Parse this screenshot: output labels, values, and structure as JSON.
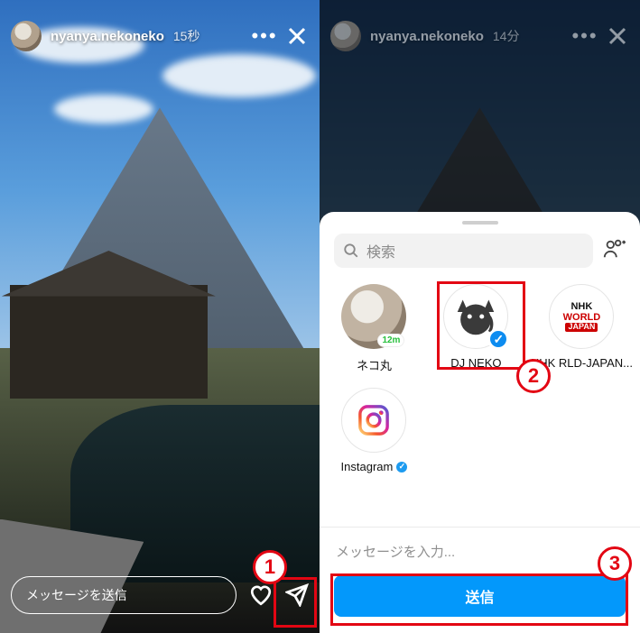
{
  "left": {
    "header": {
      "username": "nyanya.nekoneko",
      "timestamp": "15秒"
    },
    "footer": {
      "message_placeholder": "メッセージを送信"
    }
  },
  "right": {
    "header": {
      "username": "nyanya.nekoneko",
      "timestamp": "14分"
    },
    "sheet": {
      "search_placeholder": "検索",
      "contacts": [
        {
          "name": "ネコ丸",
          "active": "12m",
          "verified": false
        },
        {
          "name": "DJ NEKO",
          "verified": false,
          "selected": true
        },
        {
          "name": "NHK RLD-JAPAN...",
          "verified": false
        },
        {
          "name": "Instagram",
          "verified": true
        }
      ],
      "nhk_logo": {
        "line1": "NHK",
        "line2": "WORLD",
        "line3": "JAPAN"
      },
      "compose_placeholder": "メッセージを入力...",
      "send_label": "送信"
    }
  },
  "callouts": {
    "n1": "1",
    "n2": "2",
    "n3": "3"
  }
}
